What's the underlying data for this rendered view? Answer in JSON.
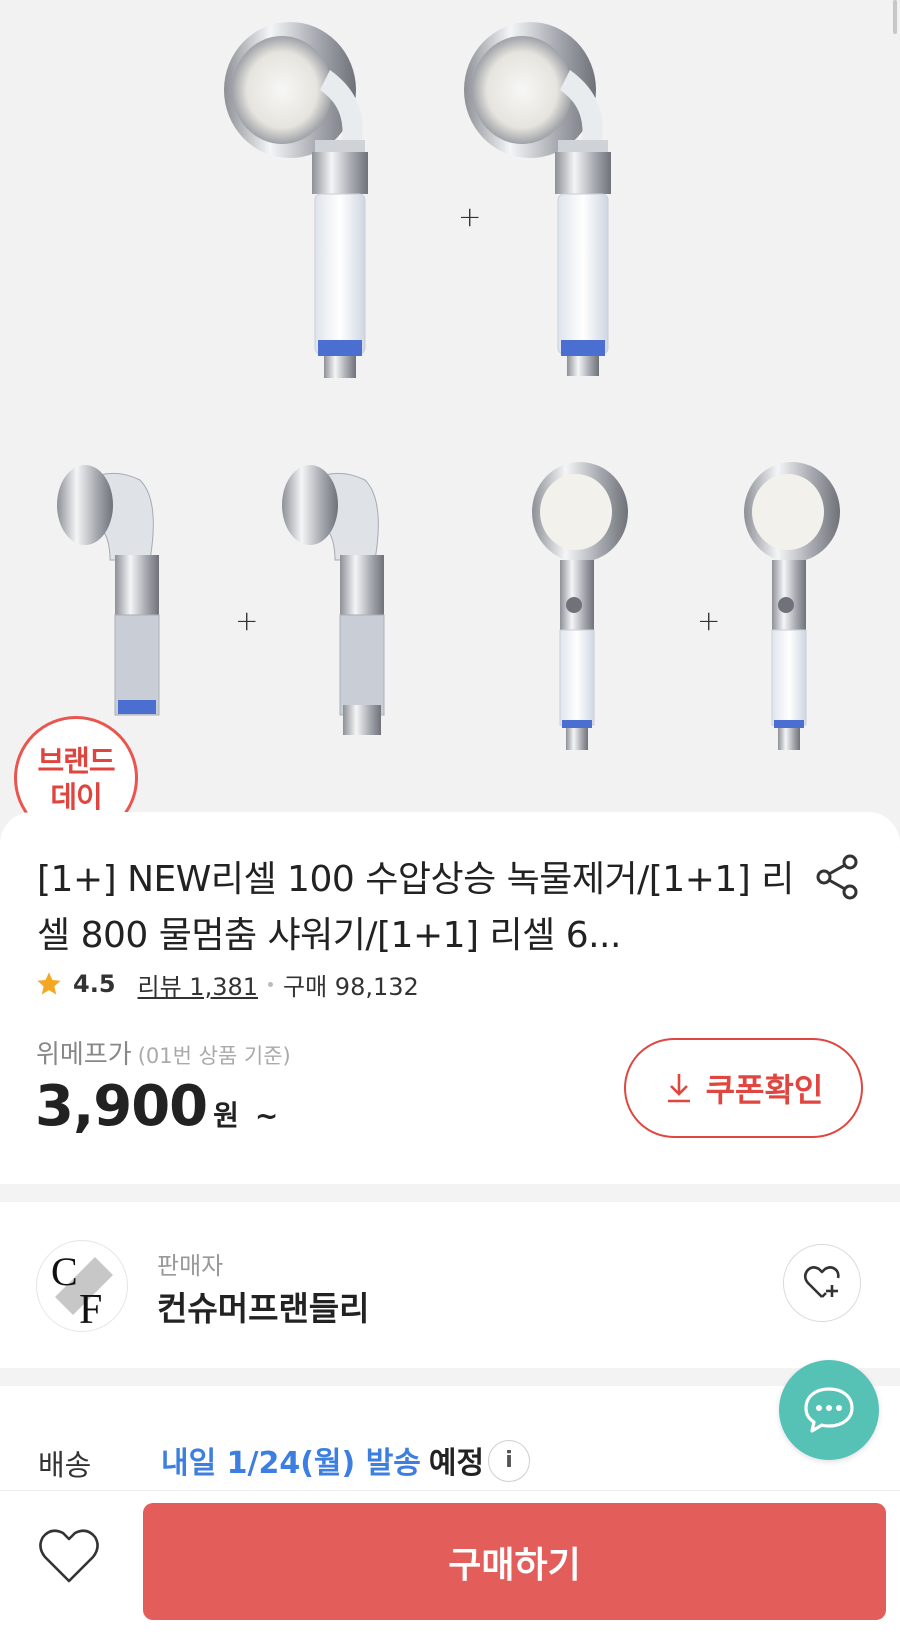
{
  "hero": {
    "plus_sign": "+",
    "badge": {
      "line1": "브랜드",
      "line2": "데이"
    }
  },
  "product": {
    "title": "[1+] NEW리셀 100 수압상승 녹물제거/[1+1] 리셀 800 물멈춤 샤워기/[1+1] 리셀 6...",
    "rating": "4.5",
    "reviews": "리뷰 1,381",
    "purchases": "구매 98,132",
    "price_label": "위메프가",
    "price_basis": "(01번 상품 기준)",
    "price": "3,900",
    "currency": "원",
    "price_suffix": "~",
    "coupon_label": "쿠폰확인",
    "star_color": "#f5a623"
  },
  "seller": {
    "label": "판매자",
    "name": "컨슈머프랜들리"
  },
  "shipping": {
    "label": "배송",
    "date": "내일 1/24(월) 발송",
    "plan": "예정",
    "info": "i"
  },
  "bottom": {
    "buy_label": "구매하기",
    "accent": "#e35d5b"
  },
  "icons": [
    "share-icon",
    "star-icon",
    "download-icon",
    "heart-plus-icon",
    "chat-icon",
    "heart-icon",
    "info-icon"
  ]
}
